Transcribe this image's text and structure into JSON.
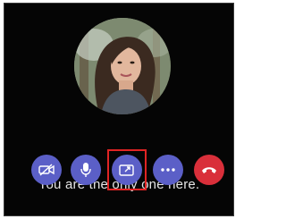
{
  "call": {
    "status_text": "You are the only one here."
  },
  "controls": [
    {
      "icon": "camera-off-icon",
      "name": "camera-toggle-button"
    },
    {
      "icon": "microphone-icon",
      "name": "microphone-button"
    },
    {
      "icon": "share-screen-icon",
      "name": "share-screen-button",
      "highlighted": true
    },
    {
      "icon": "more-options-icon",
      "name": "more-options-button"
    },
    {
      "icon": "hang-up-icon",
      "name": "hang-up-button"
    }
  ],
  "colors": {
    "background": "#050505",
    "control_purple": "#5b5fc7",
    "hang_up_red": "#d92f3a",
    "highlight_red": "#e02424",
    "text": "#e6e6e6"
  }
}
